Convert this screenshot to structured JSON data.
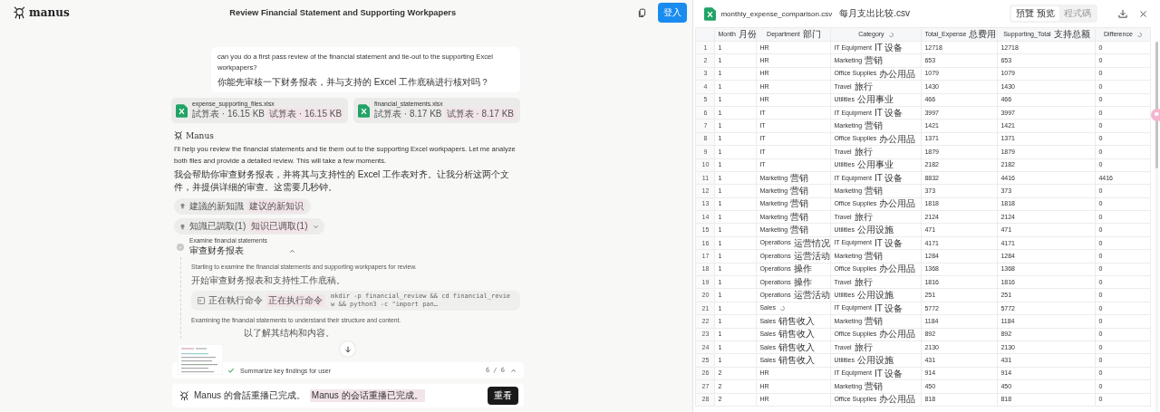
{
  "app": {
    "logo": "manus",
    "title": "Review Financial Statement and Supporting Workpapers",
    "login_button": "登入"
  },
  "chat": {
    "user_message": [
      "can you do a first pass review of the financial statement and tie-out to the supporting Excel workpapers?",
      "你能先审核一下财务报表，并与支持的 Excel 工作底稿进行核对吗？"
    ],
    "attachments": [
      {
        "name": "expense_supporting_files.xlsx",
        "meta": "試算表 · 16.15 KB",
        "meta_translated": "试算表 · 16.15 KB"
      },
      {
        "name": "financial_statements.xlsx",
        "meta": "試算表 · 8.17 KB",
        "meta_translated": "试算表 · 8.17 KB"
      }
    ],
    "assistant_name": "Manus",
    "paragraphs": [
      "I'll help you review the financial statements and tie them out to the supporting Excel workpapers. Let me analyze both files and provide a detailed review. This will take a few moments.",
      "我会帮助你审查财务报表，并将其与支持性的 Excel 工作表对齐。让我分析这两个文件，并提供详细的审查。这需要几秒钟。"
    ],
    "chips": [
      {
        "kind": "plain",
        "label": "建議的新知識",
        "translated": "建议的新知识"
      },
      {
        "kind": "dropdown",
        "label": "知識已調取(1)",
        "translated": "知识已调取(1)",
        "expanded": false
      }
    ],
    "step": {
      "title": "Examine financial statements",
      "subtitle": "审查财务报表",
      "expanded": true
    },
    "step_items": [
      {
        "kind": "text",
        "text": "Starting to examine the financial statements and supporting workpapers for review."
      },
      {
        "kind": "text",
        "text": "开始审查财务报表和支持性工作底稿。"
      },
      {
        "kind": "command",
        "label": "正在執行命令",
        "translated": "正在执行命令",
        "command": "mkdir -p financial_review && cd financial_review && python3 -c \"import pan…"
      },
      {
        "kind": "text",
        "text": "Examining the financial statements to understand their structure and content."
      },
      {
        "kind": "partial",
        "text": "以了解其结构和内容。"
      }
    ],
    "progress": {
      "task": "Summarize key findings for user",
      "count": "6 / 6",
      "done": true,
      "expanded": false
    },
    "status": {
      "text": "Manus 的會話重播已完成。",
      "translated": "Manus 的会话重播已完成。",
      "button": "重看"
    }
  },
  "viewer": {
    "file_name": "monthly_expense_comparison.csv",
    "translated_name": "每月支出比较.csv",
    "tabs": [
      {
        "label": "預覽 预览",
        "selected": true
      },
      {
        "label": "程式碼",
        "selected": false
      }
    ],
    "columns": [
      {
        "label": "Month",
        "translated": "月份"
      },
      {
        "label": "Department",
        "translated": "部门"
      },
      {
        "label": "Category",
        "translating": true
      },
      {
        "label": "Total_Expense",
        "translated": "总费用"
      },
      {
        "label": "Supporting_Total",
        "translated": "支持总额"
      },
      {
        "label": "Difference",
        "translating": true
      }
    ],
    "rows": [
      {
        "number": "1",
        "cells": [
          "1",
          "HR",
          {
            "text": "IT Equipment",
            "translated": "IT 设备"
          },
          "12718",
          "12718",
          "0"
        ]
      },
      {
        "number": "2",
        "cells": [
          "1",
          "HR",
          {
            "text": "Marketing",
            "translated": "营销"
          },
          "653",
          "653",
          "0"
        ]
      },
      {
        "number": "3",
        "cells": [
          "1",
          "HR",
          {
            "text": "Office Supplies",
            "translated": "办公用品"
          },
          "1079",
          "1079",
          "0"
        ]
      },
      {
        "number": "4",
        "cells": [
          "1",
          "HR",
          {
            "text": "Travel",
            "translated": "旅行"
          },
          "1430",
          "1430",
          "0"
        ]
      },
      {
        "number": "5",
        "cells": [
          "1",
          "HR",
          {
            "text": "Utilities",
            "translated": "公用事业"
          },
          "466",
          "466",
          "0"
        ]
      },
      {
        "number": "6",
        "cells": [
          "1",
          "IT",
          {
            "text": "IT Equipment",
            "translated": "IT 设备"
          },
          "3997",
          "3997",
          "0"
        ]
      },
      {
        "number": "7",
        "cells": [
          "1",
          "IT",
          {
            "text": "Marketing",
            "translated": "营销"
          },
          "1421",
          "1421",
          "0"
        ]
      },
      {
        "number": "8",
        "cells": [
          "1",
          "IT",
          {
            "text": "Office Supplies",
            "translated": "办公用品"
          },
          "1371",
          "1371",
          "0"
        ]
      },
      {
        "number": "9",
        "cells": [
          "1",
          "IT",
          {
            "text": "Travel",
            "translated": "旅行"
          },
          "1879",
          "1879",
          "0"
        ]
      },
      {
        "number": "10",
        "cells": [
          "1",
          "IT",
          {
            "text": "Utilities",
            "translated": "公用事业"
          },
          "2182",
          "2182",
          "0"
        ]
      },
      {
        "number": "11",
        "cells": [
          "1",
          {
            "text": "Marketing",
            "translated": "营销"
          },
          {
            "text": "IT Equipment",
            "translated": "IT 设备"
          },
          "8832",
          "4416",
          "4416"
        ]
      },
      {
        "number": "12",
        "cells": [
          "1",
          {
            "text": "Marketing",
            "translated": "营销"
          },
          {
            "text": "Marketing",
            "translated": "营销"
          },
          "373",
          "373",
          "0"
        ]
      },
      {
        "number": "13",
        "cells": [
          "1",
          {
            "text": "Marketing",
            "translated": "营销"
          },
          {
            "text": "Office Supplies",
            "translated": "办公用品"
          },
          "1818",
          "1818",
          "0"
        ]
      },
      {
        "number": "14",
        "cells": [
          "1",
          {
            "text": "Marketing",
            "translated": "营销"
          },
          {
            "text": "Travel",
            "translated": "旅行"
          },
          "2124",
          "2124",
          "0"
        ]
      },
      {
        "number": "15",
        "cells": [
          "1",
          {
            "text": "Marketing",
            "translated": "营销"
          },
          {
            "text": "Utilities",
            "translated": "公用设施"
          },
          "471",
          "471",
          "0"
        ]
      },
      {
        "number": "16",
        "cells": [
          "1",
          {
            "text": "Operations",
            "translated": "运营情况"
          },
          {
            "text": "IT Equipment",
            "translated": "IT 设备"
          },
          "4171",
          "4171",
          "0"
        ]
      },
      {
        "number": "17",
        "cells": [
          "1",
          {
            "text": "Operations",
            "translated": "运营活动"
          },
          {
            "text": "Marketing",
            "translated": "营销"
          },
          "1284",
          "1284",
          "0"
        ]
      },
      {
        "number": "18",
        "cells": [
          "1",
          {
            "text": "Operations",
            "translated": "操作"
          },
          {
            "text": "Office Supplies",
            "translated": "办公用品"
          },
          "1368",
          "1368",
          "0"
        ]
      },
      {
        "number": "19",
        "cells": [
          "1",
          {
            "text": "Operations",
            "translated": "操作"
          },
          {
            "text": "Travel",
            "translated": "旅行"
          },
          "1816",
          "1816",
          "0"
        ]
      },
      {
        "number": "20",
        "cells": [
          "1",
          {
            "text": "Operations",
            "translated": "运营活动"
          },
          {
            "text": "Utilities",
            "translated": "公用设施"
          },
          "251",
          "251",
          "0"
        ]
      },
      {
        "number": "21",
        "cells": [
          "1",
          {
            "text": "Sales",
            "translating": true
          },
          {
            "text": "IT Equipment",
            "translated": "IT 设备"
          },
          "5772",
          "5772",
          "0"
        ]
      },
      {
        "number": "22",
        "cells": [
          "1",
          {
            "text": "Sales",
            "translated": "销售收入"
          },
          {
            "text": "Marketing",
            "translated": "营销"
          },
          "1184",
          "1184",
          "0"
        ]
      },
      {
        "number": "23",
        "cells": [
          "1",
          {
            "text": "Sales",
            "translated": "销售收入"
          },
          {
            "text": "Office Supplies",
            "translated": "办公用品"
          },
          "892",
          "892",
          "0"
        ]
      },
      {
        "number": "24",
        "cells": [
          "1",
          {
            "text": "Sales",
            "translated": "销售收入"
          },
          {
            "text": "Travel",
            "translated": "旅行"
          },
          "2130",
          "2130",
          "0"
        ]
      },
      {
        "number": "25",
        "cells": [
          "1",
          {
            "text": "Sales",
            "translated": "销售收入"
          },
          {
            "text": "Utilities",
            "translated": "公用设施"
          },
          "431",
          "431",
          "0"
        ]
      },
      {
        "number": "26",
        "cells": [
          "2",
          "HR",
          {
            "text": "IT Equipment",
            "translated": "IT 设备"
          },
          "914",
          "914",
          "0"
        ]
      },
      {
        "number": "27",
        "cells": [
          "2",
          "HR",
          {
            "text": "Marketing",
            "translated": "营销"
          },
          "450",
          "450",
          "0"
        ]
      },
      {
        "number": "28",
        "cells": [
          "2",
          "HR",
          {
            "text": "Office Supplies",
            "translated": "办公用品"
          },
          "818",
          "818",
          "0"
        ]
      }
    ]
  }
}
